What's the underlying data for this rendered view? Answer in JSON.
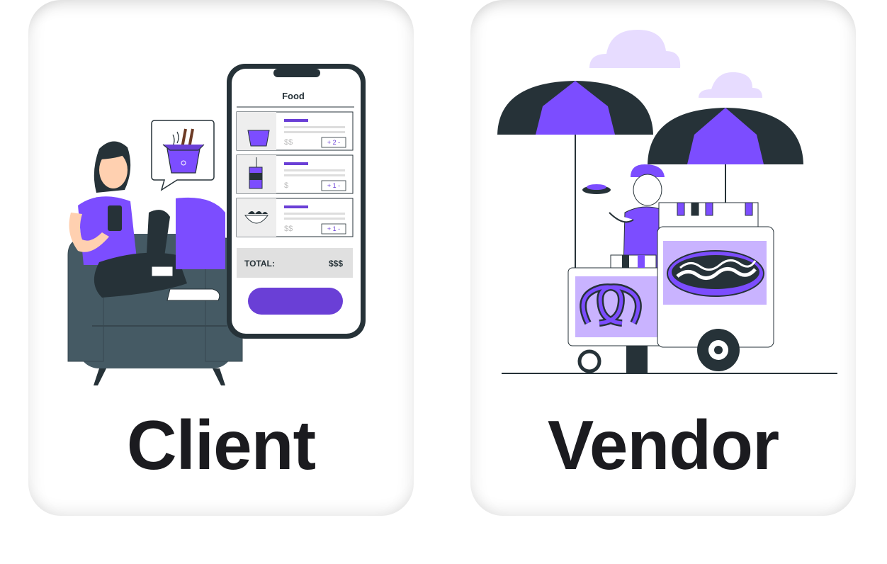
{
  "cards": [
    {
      "label": "Client"
    },
    {
      "label": "Vendor"
    }
  ],
  "phone": {
    "title": "Food",
    "items": [
      {
        "price": "$$",
        "qty": "+ 2 -"
      },
      {
        "price": "$",
        "qty": "+ 1 -"
      },
      {
        "price": "$$",
        "qty": "+ 1 -"
      }
    ],
    "total_label": "TOTAL:",
    "total_value": "$$$"
  },
  "colors": {
    "accent": "#7c4dff",
    "accent_dark": "#6a3fd6",
    "dark": "#263238",
    "chair": "#455a64"
  }
}
